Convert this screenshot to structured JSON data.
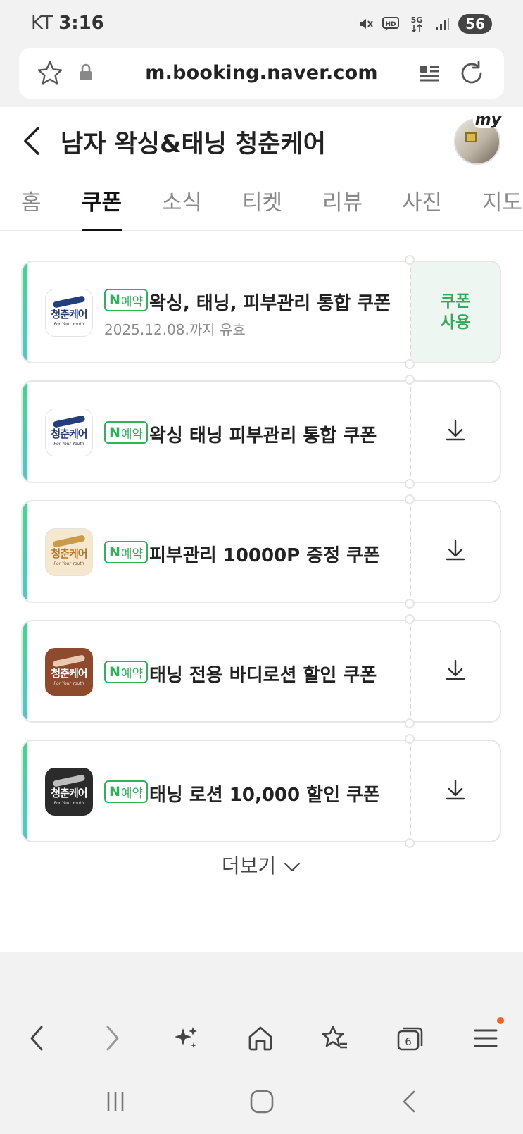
{
  "status": {
    "carrier": "KT",
    "time": "3:16",
    "battery": "56"
  },
  "browser": {
    "url": "m.booking.naver.com"
  },
  "header": {
    "title": "남자 왁싱&태닝 청춘케어",
    "avatar_badge": "my"
  },
  "tabs": [
    {
      "label": "홈"
    },
    {
      "label": "쿠폰"
    },
    {
      "label": "소식"
    },
    {
      "label": "티켓"
    },
    {
      "label": "리뷰"
    },
    {
      "label": "사진"
    },
    {
      "label": "지도"
    }
  ],
  "coupons": [
    {
      "badge_n": "N",
      "badge_label": "예약",
      "title": "왁싱, 태닝, 피부관리 통합 쿠폰",
      "valid": "2025.12.08.까지 유효",
      "action_line1": "쿠폰",
      "action_line2": "사용",
      "logo_name": "청춘케어",
      "logo_sub": "For Your Youth"
    },
    {
      "badge_n": "N",
      "badge_label": "예약",
      "title": "왁싱 태닝 피부관리 통합 쿠폰",
      "logo_name": "청춘케어",
      "logo_sub": "For Your Youth"
    },
    {
      "badge_n": "N",
      "badge_label": "예약",
      "title": "피부관리 10000P 증정 쿠폰",
      "logo_name": "청춘케어",
      "logo_sub": "For Your Youth"
    },
    {
      "badge_n": "N",
      "badge_label": "예약",
      "title": "태닝 전용 바디로션 할인 쿠폰",
      "logo_name": "청춘케어",
      "logo_sub": "For Your Youth"
    },
    {
      "badge_n": "N",
      "badge_label": "예약",
      "title": "태닝 로션 10,000 할인 쿠폰",
      "logo_name": "청춘케어",
      "logo_sub": "For Your Youth"
    }
  ],
  "more": {
    "label": "더보기"
  },
  "toolbar": {
    "tabs_count": "6"
  },
  "colors": {
    "accent_green": "#2db35b",
    "notification_dot": "#e8652c"
  }
}
